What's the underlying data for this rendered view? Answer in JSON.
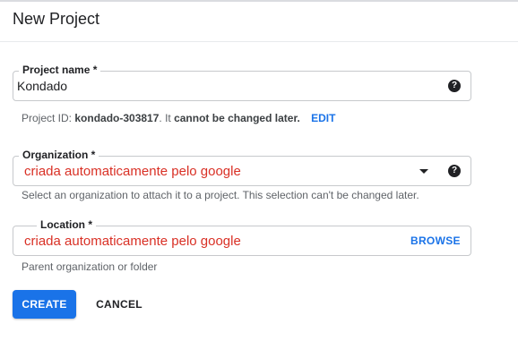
{
  "dialog": {
    "title": "New Project"
  },
  "project_name": {
    "label": "Project name *",
    "value": "Kondado",
    "help_icon": "question-circle-icon"
  },
  "project_id": {
    "prefix": "Project ID: ",
    "id": "kondado-303817",
    "middle": ". It ",
    "warning": "cannot be changed later.",
    "edit_label": "EDIT"
  },
  "organization": {
    "label": "Organization *",
    "value": "criada automaticamente pelo google",
    "dropdown_icon": "caret-down-icon",
    "help_icon": "question-circle-icon",
    "hint": "Select an organization to attach it to a project. This selection can't be changed later."
  },
  "location": {
    "label": "Location *",
    "value": "criada automaticamente pelo google",
    "browse_label": "BROWSE",
    "hint": "Parent organization or folder"
  },
  "actions": {
    "create_label": "CREATE",
    "cancel_label": "CANCEL"
  },
  "colors": {
    "primary": "#1a73e8",
    "error_text": "#d93025"
  }
}
